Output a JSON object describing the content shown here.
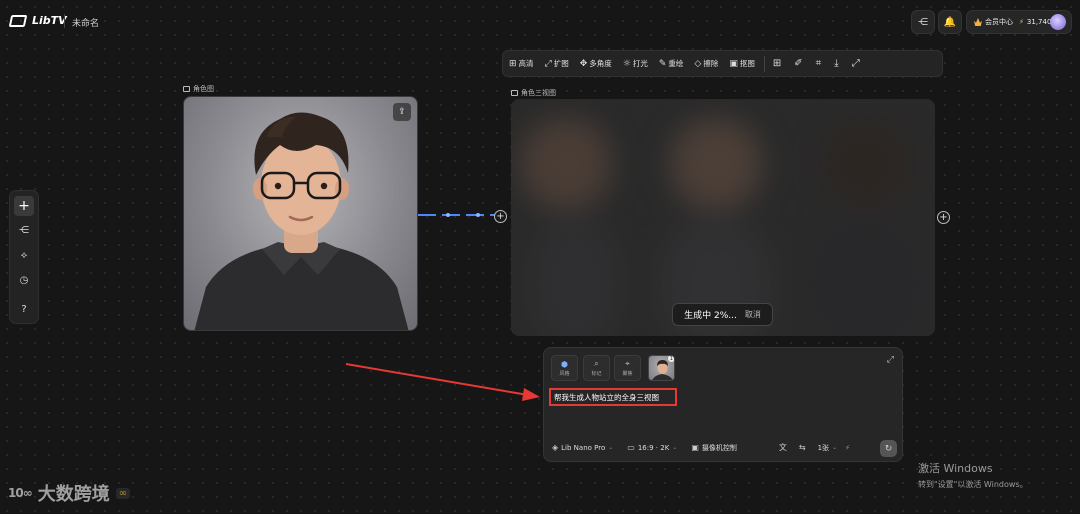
{
  "app": {
    "name": "LibTV",
    "doc_title": "未命名"
  },
  "header": {
    "share_icon": "share-icon",
    "bell_icon": "bell-icon",
    "member_label": "会员中心",
    "credits_icon": "lightning-icon",
    "credits": "31,740"
  },
  "toolbar": {
    "tools": [
      {
        "icon": "hd-icon",
        "glyph": "⊞",
        "label": "高清"
      },
      {
        "icon": "expand-image-icon",
        "glyph": "⤢",
        "label": "扩图"
      },
      {
        "icon": "multi-angle-icon",
        "glyph": "✥",
        "label": "多角度"
      },
      {
        "icon": "light-icon",
        "glyph": "☼",
        "label": "打光"
      },
      {
        "icon": "redraw-icon",
        "glyph": "✎",
        "label": "重绘"
      },
      {
        "icon": "eraser-icon",
        "glyph": "◇",
        "label": "擦除"
      },
      {
        "icon": "cutout-icon",
        "glyph": "▣",
        "label": "抠图"
      }
    ],
    "icon_tools": [
      "grid-icon",
      "brush-icon",
      "crop-icon",
      "download-icon",
      "fullscreen-icon"
    ]
  },
  "nodes": {
    "source": {
      "label": "角色图"
    },
    "generated": {
      "label": "角色三视图",
      "progress_text": "生成中 2%...",
      "cancel_label": "取消",
      "progress_percent": 2
    }
  },
  "prompt_panel": {
    "chips": [
      {
        "icon": "style-icon",
        "label": "风格"
      },
      {
        "icon": "mark-icon",
        "label": "标记"
      },
      {
        "icon": "focus-icon",
        "label": "聚焦"
      }
    ],
    "reference_count": "1",
    "prompt": "帮我生成人物站立的全身三视图",
    "model": "Lib Nano Pro",
    "aspect": "16:9 · 2K",
    "camera": "摄像机控制",
    "count": "1张"
  },
  "watermarks": {
    "windows_line1": "激活 Windows",
    "windows_line2": "转到\"设置\"以激活 Windows。",
    "brand_mark": "大数跨境"
  },
  "colors": {
    "accent": "#3b82f6",
    "highlight_box": "#e53935",
    "crown": "#f0b23c"
  }
}
